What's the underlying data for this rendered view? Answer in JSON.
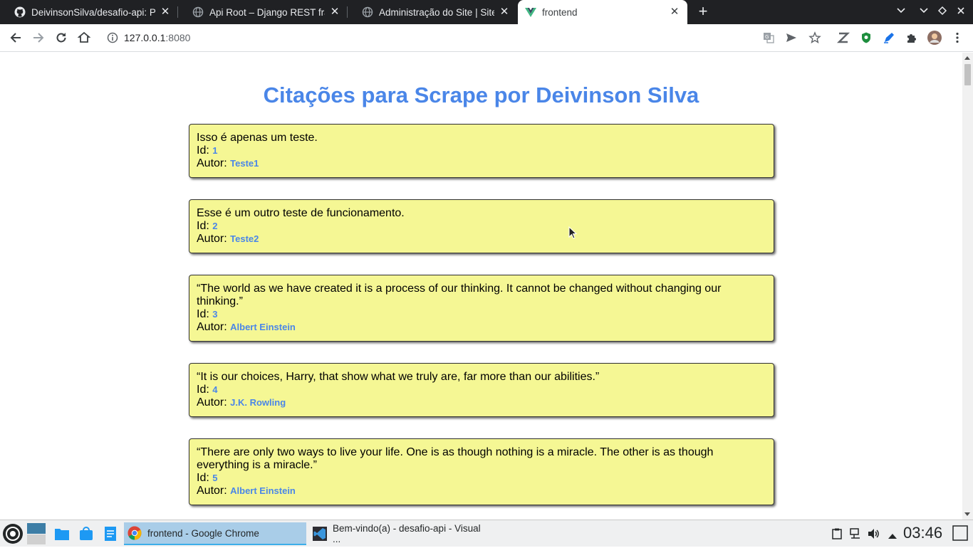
{
  "tabs": [
    {
      "title": "DeivinsonSilva/desafio-api: Pr",
      "icon": "github-icon"
    },
    {
      "title": "Api Root – Django REST frame",
      "icon": "globe-icon"
    },
    {
      "title": "Administração do Site | Site d",
      "icon": "globe-icon"
    },
    {
      "title": "frontend",
      "icon": "vue-icon"
    }
  ],
  "toolbar": {
    "url_host": "127.0.0.1",
    "url_port": ":8080"
  },
  "page": {
    "title": "Citações para Scrape por Deivinson Silva",
    "id_label": "Id:",
    "author_label": "Autor:",
    "quotes": [
      {
        "text": "Isso é apenas um teste.",
        "id": "1",
        "author": "Teste1"
      },
      {
        "text": "Esse é um outro teste de funcionamento.",
        "id": "2",
        "author": "Teste2"
      },
      {
        "text": "“The world as we have created it is a process of our thinking. It cannot be changed without changing our thinking.”",
        "id": "3",
        "author": "Albert Einstein"
      },
      {
        "text": "“It is our choices, Harry, that show what we truly are, far more than our abilities.”",
        "id": "4",
        "author": "J.K. Rowling"
      },
      {
        "text": "“There are only two ways to live your life. One is as though nothing is a miracle. The other is as though everything is a miracle.”",
        "id": "5",
        "author": "Albert Einstein"
      }
    ]
  },
  "taskbar": {
    "tasks": [
      {
        "label": "frontend - Google Chrome",
        "icon": "chrome-icon"
      },
      {
        "label": "Bem-vindo(a) - desafio-api - Visual ...",
        "icon": "vscode-icon"
      }
    ],
    "clock": "03:46"
  },
  "colors": {
    "accent": "#4a86e8",
    "card_bg": "#f5f794",
    "tabstrip_bg": "#202124"
  }
}
